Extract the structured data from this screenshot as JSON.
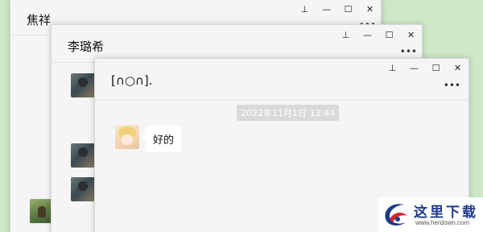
{
  "windows": [
    {
      "id": "chat-window-1",
      "title": "焦祥"
    },
    {
      "id": "chat-window-2",
      "title": "李璐希"
    },
    {
      "id": "chat-window-3",
      "title": "[∩○∩].",
      "timestamp": "2022年11月1日 13:44",
      "messages": [
        {
          "sender_avatar": "anime-avatar",
          "text": "好的"
        }
      ]
    }
  ],
  "controls": {
    "pin": "⊥",
    "minimize": "—",
    "maximize": "☐",
    "close": "✕",
    "more": "•••"
  },
  "watermark": {
    "name": "这里下载",
    "url": "www.herdown.com"
  }
}
